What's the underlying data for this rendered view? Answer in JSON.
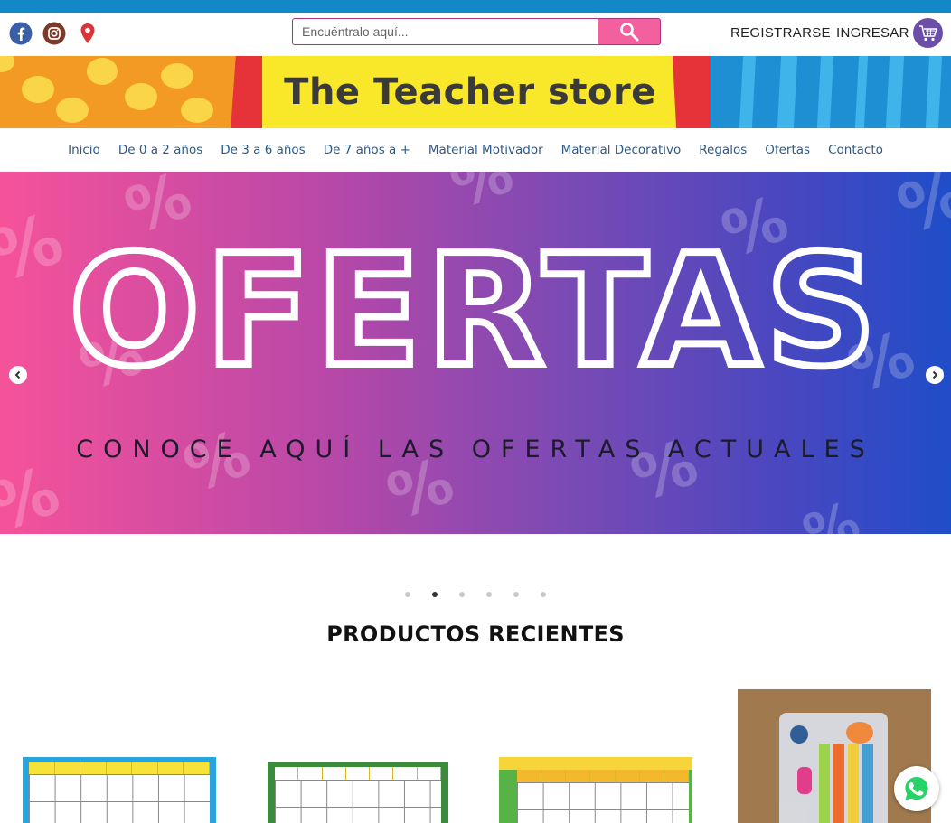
{
  "header": {
    "search_placeholder": "Encuéntralo aquí...",
    "register_label": "REGISTRARSE",
    "login_label": "INGRESAR",
    "social_icons": [
      "facebook-icon",
      "instagram-icon",
      "location-pin-icon"
    ]
  },
  "banner": {
    "title": "The Teacher store"
  },
  "nav": {
    "items": [
      {
        "label": "Inicio"
      },
      {
        "label": "De 0 a 2 años"
      },
      {
        "label": "De 3 a 6 años"
      },
      {
        "label": "De 7 años a +"
      },
      {
        "label": "Material Motivador"
      },
      {
        "label": "Material Decorativo"
      },
      {
        "label": "Regalos"
      },
      {
        "label": "Ofertas"
      },
      {
        "label": "Contacto"
      }
    ]
  },
  "hero": {
    "title": "OFERTAS",
    "subtitle": "CONOCE AQUÍ LAS OFERTAS ACTUALES",
    "slide_count": 6,
    "active_slide": 2
  },
  "section": {
    "title": "PRODUCTOS RECIENTES"
  },
  "colors": {
    "top_strip": "#1487c8",
    "search_button": "#f2609e",
    "cart": "#6b4ea8",
    "nav_text": "#2a5a8a",
    "hero_start": "#f6529a",
    "hero_end": "#1f4dc8",
    "whatsapp": "#25d366"
  }
}
